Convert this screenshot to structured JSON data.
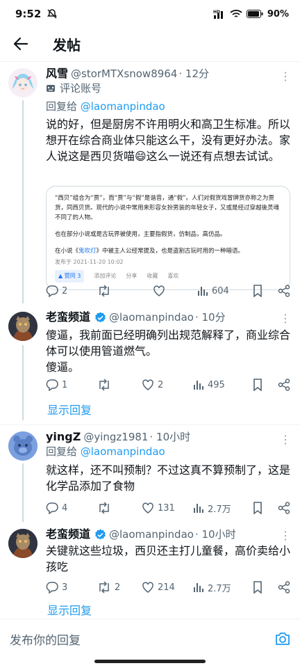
{
  "status": {
    "time": "9:52",
    "battery": "90%"
  },
  "header": {
    "title": "发帖"
  },
  "tweets": [
    {
      "name": "风雪",
      "handle": "@storMTXsnow8964",
      "time": "· 12分",
      "badge": "评论账号",
      "reply_prefix": "回复给 ",
      "reply_to": "@laomanpindao",
      "text": "说的好，但是厨房不许用明火和高卫生标准。所以想开在综合商业体只能这么干，没有更好办法。家人说这是西贝货喵😄这么一说还有点想去试试。",
      "card": {
        "p1": "“西贝”组合为“贾”，而“贾”与“假”是谐音，通“假”。人们对假货戏冒牌货亦称之为贾货，同西贝货。现代的小说中常用来形容女扮男装的年轻女子，又或是经过穿越後灵魂不同了的人物。",
        "p2": "也在部分小说或是古玩界被使用，主要指假货，仿制品，高仿品。",
        "p3_pre": "在小说《",
        "p3_link": "鬼吹灯",
        "p3_post": "》中被主人公经常提及，也是盗割古玩时用的一种暗语。",
        "date": "发布于 2021-11-20 10:02",
        "vote": "▲ 赞同 3",
        "comment": "添加评论",
        "share": "分享",
        "fav": "收藏",
        "like": "喜欢"
      },
      "replies": "2",
      "retweets": "",
      "likes": "",
      "views": "604"
    },
    {
      "name": "老蛮频道",
      "handle": "@laomanpindao",
      "time": "· 10分",
      "text": "傻逼，我前面已经明确列出规范解释了，商业综合体可以使用管道燃气。\n傻逼。",
      "replies": "1",
      "retweets": "",
      "likes": "2",
      "views": "495",
      "show_reply": "显示回复"
    },
    {
      "name": "yingZ",
      "handle": "@yingz1981",
      "time": "· 10小时",
      "reply_prefix": "回复给 ",
      "reply_to": "@laomanpindao",
      "text": "就这样，还不叫预制？不过这真不算预制了，这是化学品添加了食物",
      "replies": "4",
      "retweets": "",
      "likes": "131",
      "views": "2.7万"
    },
    {
      "name": "老蛮频道",
      "handle": "@laomanpindao",
      "time": "· 10小时",
      "text": "关键就这些垃圾，西贝还主打儿童餐，高价卖给小孩吃",
      "replies": "3",
      "retweets": "2",
      "likes": "214",
      "views": "2.7万",
      "show_reply": "显示回复"
    }
  ],
  "composer": {
    "placeholder": "发布你的回复"
  },
  "colors": {
    "accent": "#1d9bf0",
    "verified": "#1d9bf0"
  }
}
